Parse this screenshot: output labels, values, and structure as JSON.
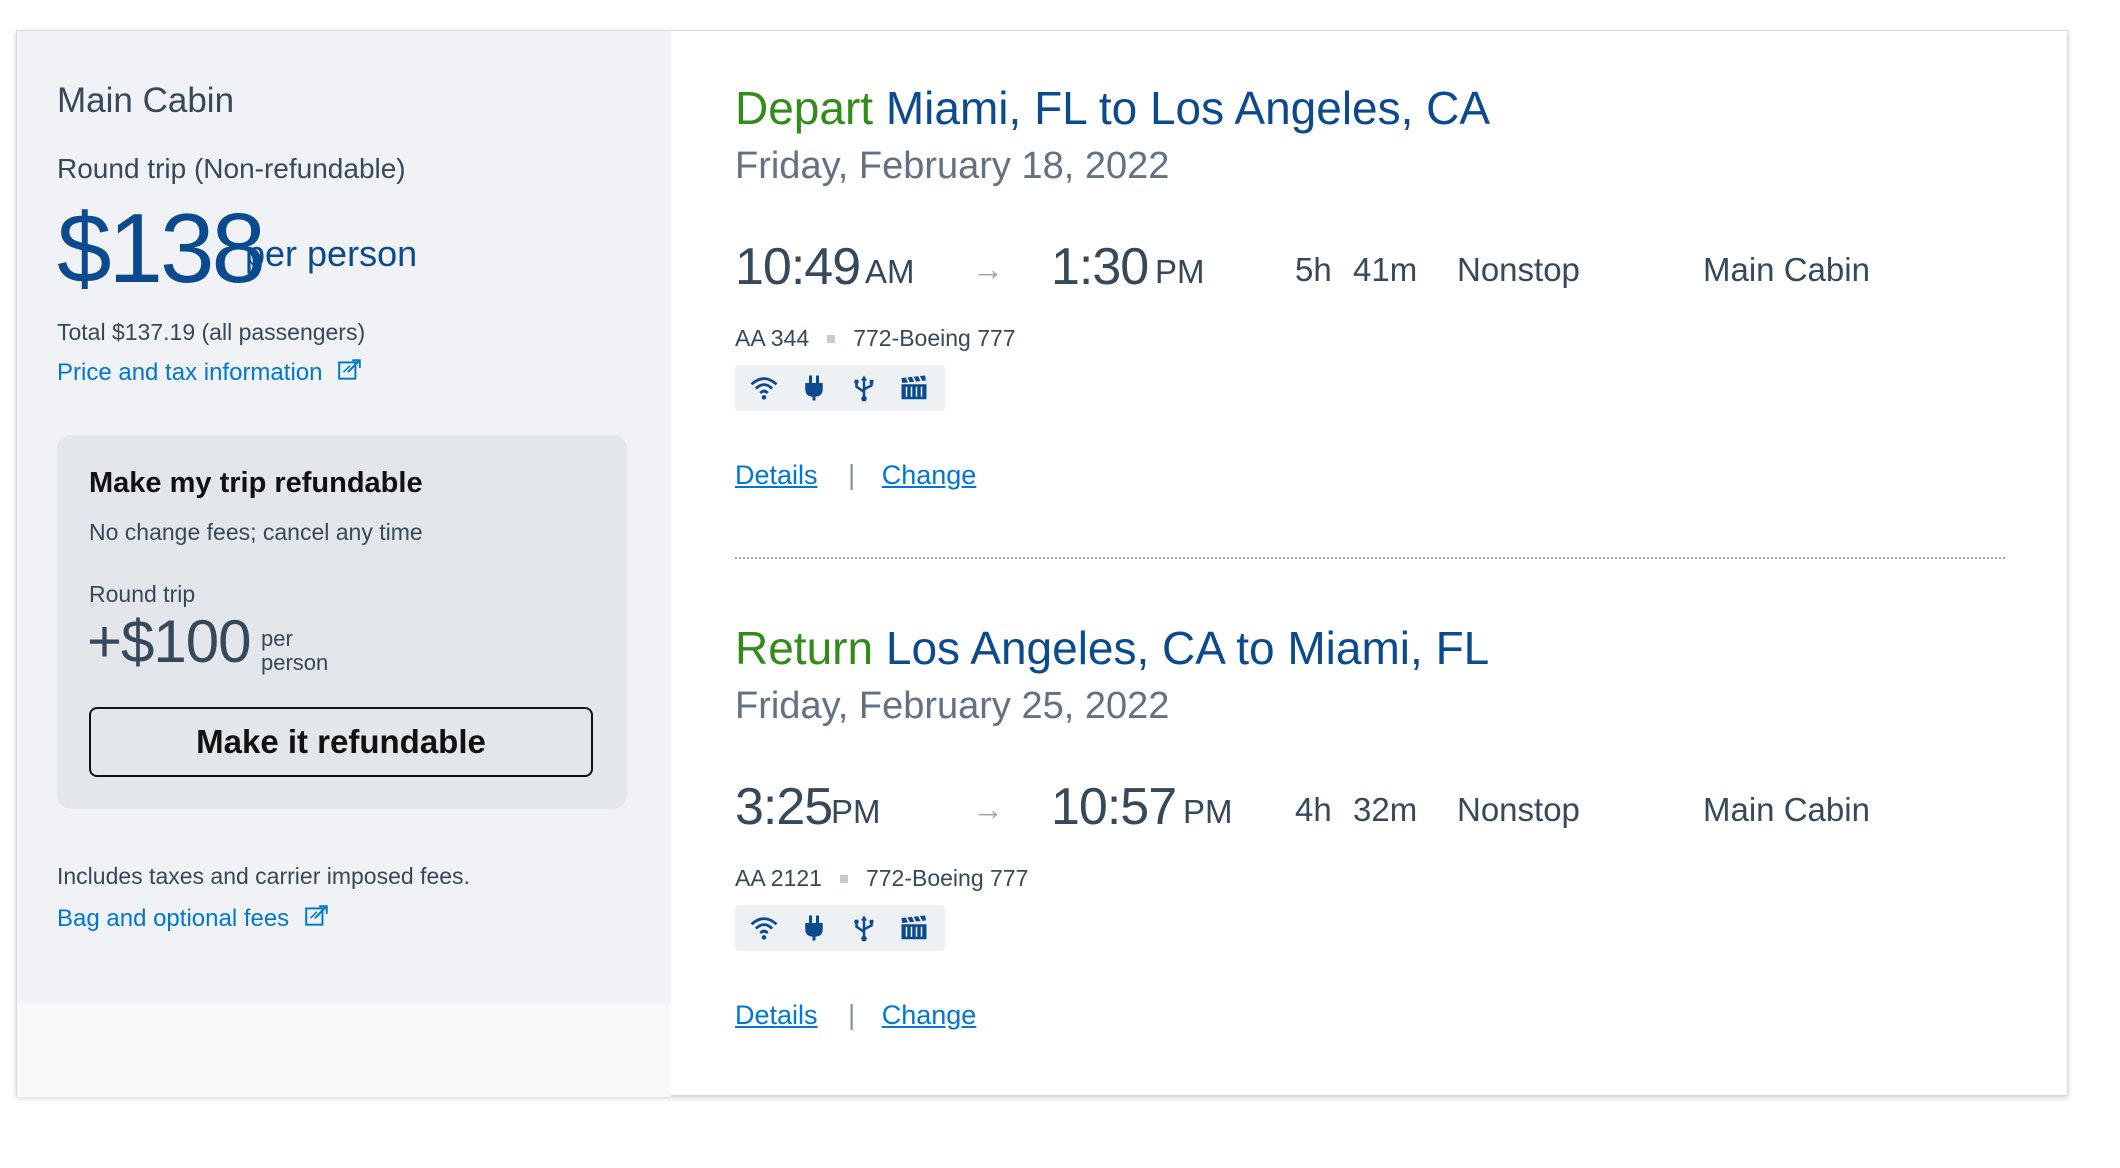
{
  "fare": {
    "cabin": "Main Cabin",
    "trip_type": "Round trip (Non-refundable)",
    "price": "$138",
    "per_person": "per person",
    "total": "Total $137.19 (all passengers)",
    "price_tax_link": "Price and tax information"
  },
  "refundable": {
    "title": "Make my trip refundable",
    "subtitle": "No change fees; cancel any time",
    "trip_label": "Round trip",
    "price": "+$100",
    "per_line1": "per",
    "per_line2": "person",
    "button": "Make it refundable"
  },
  "fees": {
    "includes": "Includes taxes and carrier imposed fees.",
    "bag_link": "Bag and optional fees"
  },
  "flights": [
    {
      "direction": "Depart",
      "route": "Miami, FL to Los Angeles, CA",
      "date": "Friday, February 18, 2022",
      "dep_time": "10:49",
      "dep_ampm": "AM",
      "arr_time": "1:30",
      "arr_ampm": "PM",
      "duration_h": "5h",
      "duration_m": "41m",
      "stops": "Nonstop",
      "cabin": "Main Cabin",
      "flight_number": "AA 344",
      "aircraft": "772-Boeing 777",
      "amenities": [
        "wifi-icon",
        "power-outlet-icon",
        "usb-icon",
        "entertainment-icon"
      ],
      "details_label": "Details",
      "separator": "|",
      "change_label": "Change"
    },
    {
      "direction": "Return",
      "route": "Los Angeles, CA to Miami, FL",
      "date": "Friday, February 25, 2022",
      "dep_time": "3:25",
      "dep_ampm": "PM",
      "arr_time": "10:57",
      "arr_ampm": "PM",
      "duration_h": "4h",
      "duration_m": "32m",
      "stops": "Nonstop",
      "cabin": "Main Cabin",
      "flight_number": "AA 2121",
      "aircraft": "772-Boeing 777",
      "amenities": [
        "wifi-icon",
        "power-outlet-icon",
        "usb-icon",
        "entertainment-icon"
      ],
      "details_label": "Details",
      "separator": "|",
      "change_label": "Change"
    }
  ],
  "colors": {
    "accent_green": "#328c1a",
    "brand_blue": "#0b4a8f",
    "link_blue": "#0078d2",
    "text_dark": "#36495a",
    "text_gray": "#627282",
    "sidebar_bg": "#f0f2f5"
  }
}
